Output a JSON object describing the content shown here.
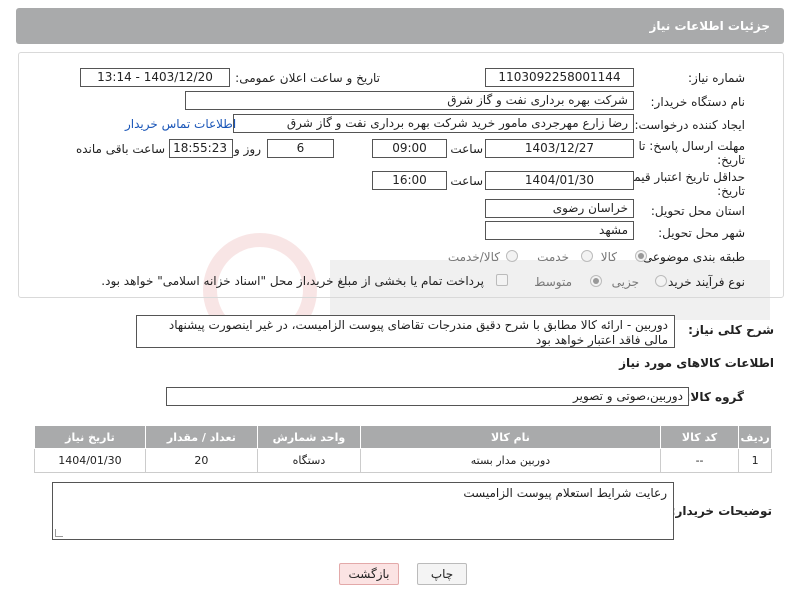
{
  "header": {
    "title": "جزئیات اطلاعات نیاز"
  },
  "form": {
    "need_number_label": "شماره نیاز:",
    "need_number": "1103092258001144",
    "announce_label": "تاریخ و ساعت اعلان عمومی:",
    "announce_value": "1403/12/20 - 13:14",
    "buyer_org_label": "نام دستگاه خریدار:",
    "buyer_org": "شرکت بهره برداری نفت و گاز شرق",
    "creator_label": "ایجاد کننده درخواست:",
    "creator": "رضا زارع مهرجردی مامور خرید شرکت بهره برداری نفت و گاز شرق",
    "contact_link": "اطلاعات تماس خریدار",
    "deadline_label_1": "مهلت ارسال پاسخ: تا",
    "deadline_label_2": "تاریخ:",
    "deadline_date": "1403/12/27",
    "time_label": "ساعت",
    "deadline_time": "09:00",
    "days_value": "6",
    "days_label": "روز و",
    "remaining_time": "18:55:23",
    "remaining_label": "ساعت باقی مانده",
    "min_validity_label_1": "حداقل تاریخ اعتبار قیمت: تا",
    "min_validity_label_2": "تاریخ:",
    "validity_date": "1404/01/30",
    "validity_time": "16:00",
    "province_label": "استان محل تحویل:",
    "province": "خراسان رضوی",
    "city_label": "شهر محل تحویل:",
    "city": "مشهد",
    "category_label": "طبقه بندی موضوعی:",
    "category_options": [
      "کالا",
      "خدمت",
      "کالا/خدمت"
    ],
    "process_label": "نوع فرآیند خرید :",
    "process_options": [
      "جزیی",
      "متوسط"
    ],
    "payment_note": "پرداخت تمام یا بخشی از مبلغ خرید،از محل \"اسناد خزانه اسلامی\" خواهد بود."
  },
  "description": {
    "label": "شرح کلی نیاز:",
    "text": "دوربین - ارائه کالا مطابق با شرح دقیق مندرجات تقاضای پیوست الزامیست، در غیر اینصورت پیشنهاد مالی فاقد اعتبار خواهد بود"
  },
  "goods_info": {
    "title": "اطلاعات کالاهای مورد نیاز",
    "group_label": "گروه کالا:",
    "group_value": "دوربین،صوتی و تصویر"
  },
  "table": {
    "headers": [
      "ردیف",
      "کد کالا",
      "نام کالا",
      "واحد شمارش",
      "تعداد / مقدار",
      "تاریخ نیاز"
    ],
    "rows": [
      [
        "1",
        "--",
        "دوربین مدار بسته",
        "دستگاه",
        "20",
        "1404/01/30"
      ]
    ]
  },
  "notes": {
    "label": "توضیحات خریدار:",
    "text": "رعایت شرایط استعلام پیوست الزامیست"
  },
  "buttons": {
    "print": "چاپ",
    "back": "بازگشت"
  }
}
